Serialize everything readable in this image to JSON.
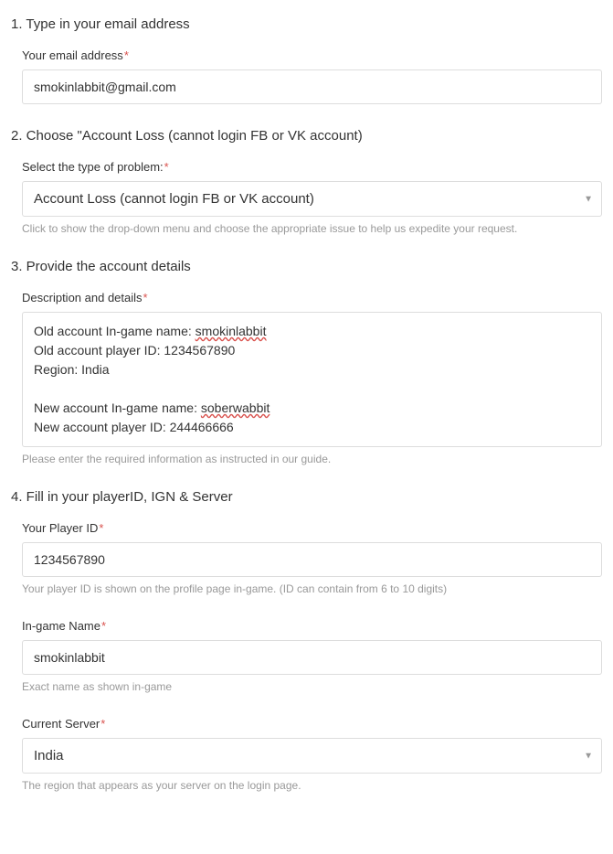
{
  "step1": {
    "heading": "1. Type in your email address",
    "label": "Your email address",
    "value": "smokinlabbit@gmail.com"
  },
  "step2": {
    "heading": "2. Choose \"Account Loss (cannot login FB or VK account)",
    "label": "Select the type of problem:",
    "value": "Account Loss (cannot login FB or VK account)",
    "hint": "Click to show the drop-down menu and choose the appropriate issue to help us expedite your request."
  },
  "step3": {
    "heading": "3. Provide the account details",
    "label": "Description and details",
    "value_line1_pre": "Old account In-game name: ",
    "value_line1_spell": "smokinlabbit",
    "value_line2": "Old account player ID: 1234567890",
    "value_line3": "Region: India",
    "value_line4_pre": "New account In-game name: ",
    "value_line4_spell": "soberwabbit",
    "value_line5": "New account player ID: 244466666",
    "hint": "Please enter the required information as instructed in our guide."
  },
  "step4": {
    "heading": "4. Fill in your playerID, IGN & Server",
    "playerId": {
      "label": "Your Player ID",
      "value": "1234567890",
      "hint": "Your player ID is shown on the profile page in-game. (ID can contain from 6 to 10 digits)"
    },
    "ign": {
      "label": "In-game Name",
      "value": "smokinlabbit",
      "hint": "Exact name as shown in-game"
    },
    "server": {
      "label": "Current Server",
      "value": "India",
      "hint": "The region that appears as your server on the login page."
    }
  }
}
